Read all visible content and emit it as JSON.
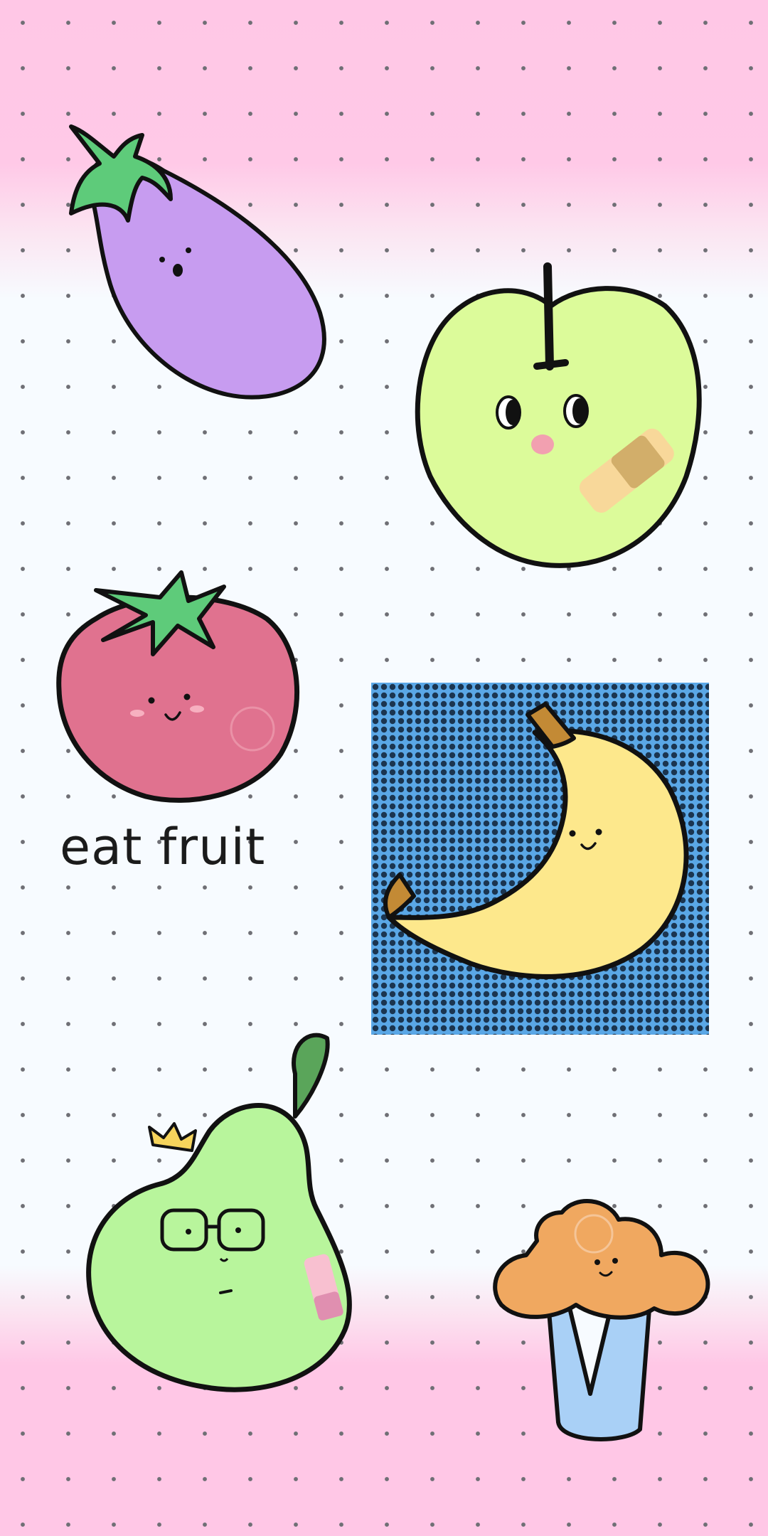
{
  "wallpaper": {
    "caption": "eat fruit",
    "colors": {
      "top_band": "#ffc7e6",
      "middle": "#f7fbff",
      "dots": "#6f6f75",
      "banana_panel": "#5aa7e6"
    }
  },
  "stickers": [
    {
      "name": "eggplant",
      "color": "#c79cf0"
    },
    {
      "name": "apple",
      "color": "#dcfb9a"
    },
    {
      "name": "tomato",
      "color": "#e0728f"
    },
    {
      "name": "banana",
      "color": "#fde88c"
    },
    {
      "name": "pear",
      "color": "#b8f59c"
    },
    {
      "name": "broccoli",
      "color": "#f0a860"
    }
  ]
}
